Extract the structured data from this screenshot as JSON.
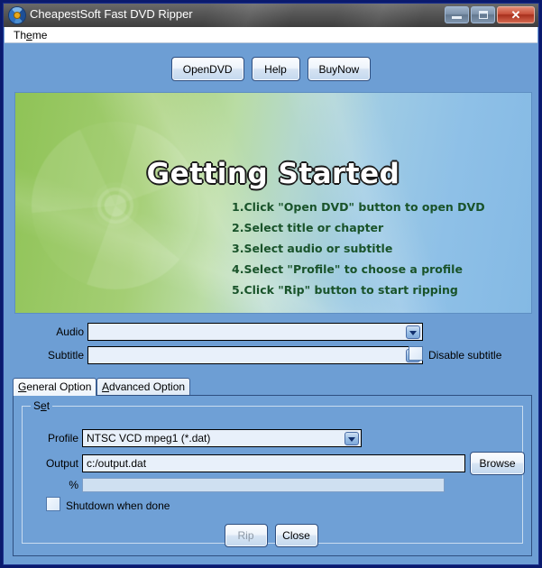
{
  "window": {
    "title": "CheapestSoft Fast DVD Ripper",
    "app_icon": "dvd-disc-icon",
    "controls": {
      "minimize": "minimize-icon",
      "maximize": "maximize-icon",
      "close": "✕"
    }
  },
  "menubar": {
    "items": [
      {
        "label_pre": "Th",
        "label_accel": "e",
        "label_post": "me"
      }
    ]
  },
  "toolbar": {
    "buttons": [
      {
        "label": "OpenDVD"
      },
      {
        "label": "Help"
      },
      {
        "label": "BuyNow"
      }
    ]
  },
  "banner": {
    "title": "Getting Started",
    "steps": [
      "1.Click \"Open DVD\" button to open DVD",
      "2.Select title or chapter",
      "3.Select audio or subtitle",
      "4.Select \"Profile\" to choose a profile",
      "5.Click \"Rip\" button to start ripping"
    ],
    "gradient_left": "#8fc356",
    "gradient_right": "#84b9e4",
    "step_color": "#19532a",
    "watermark": "dvd-disc-watermark"
  },
  "tracks": {
    "audio_label": "Audio",
    "audio_value": "",
    "subtitle_label": "Subtitle",
    "subtitle_value": "",
    "disable_subtitle_label": "Disable subtitle",
    "disable_subtitle_checked": false
  },
  "tabs": [
    {
      "label_pre": "",
      "label_accel": "G",
      "label_post": "eneral Option",
      "selected": true
    },
    {
      "label_pre": "",
      "label_accel": "A",
      "label_post": "dvanced Option",
      "selected": false
    }
  ],
  "general_option": {
    "group_legend_pre": "S",
    "group_legend_accel": "e",
    "group_legend_post": "t",
    "profile_label": "Profile",
    "profile_value": "NTSC VCD mpeg1  (*.dat)",
    "output_label": "Output",
    "output_value": "c:/output.dat",
    "browse_label": "Browse",
    "percent_label": "%",
    "progress_value": 0,
    "shutdown_label": "Shutdown when done",
    "shutdown_checked": false
  },
  "footer": {
    "rip_label": "Rip",
    "rip_enabled": false,
    "close_label": "Close",
    "close_enabled": true
  }
}
